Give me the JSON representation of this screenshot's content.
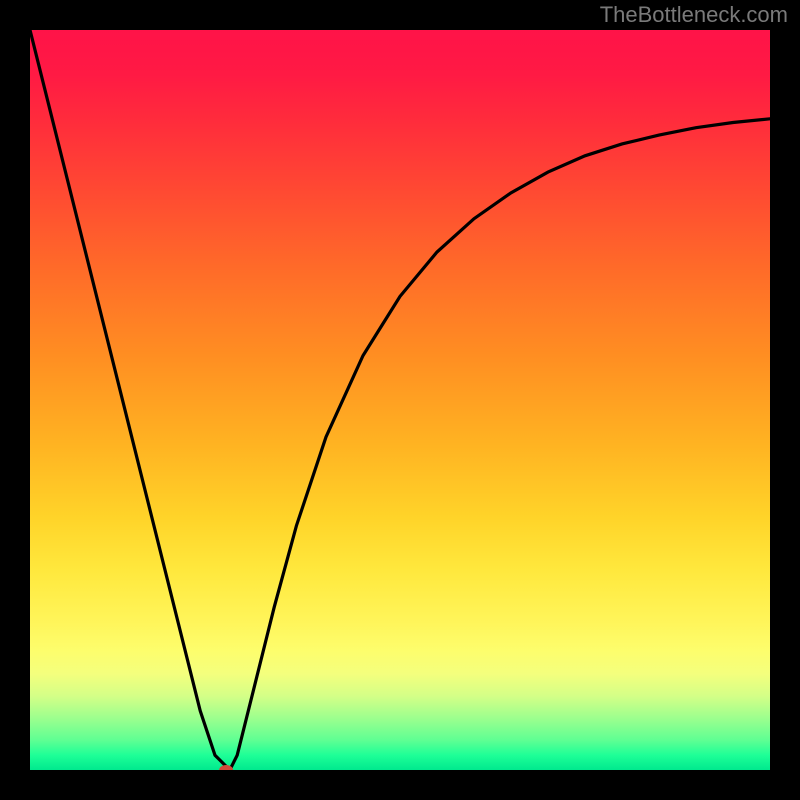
{
  "attribution": "TheBottleneck.com",
  "chart_data": {
    "type": "line",
    "title": "",
    "xlabel": "",
    "ylabel": "",
    "xlim": [
      0,
      100
    ],
    "ylim": [
      0,
      100
    ],
    "grid": false,
    "background_gradient": {
      "type": "vertical",
      "stops": [
        {
          "pos": 0,
          "color": "#ff1348"
        },
        {
          "pos": 50,
          "color": "#ffa020"
        },
        {
          "pos": 80,
          "color": "#fff55a"
        },
        {
          "pos": 100,
          "color": "#00e98e"
        }
      ]
    },
    "series": [
      {
        "name": "bottleneck-curve",
        "color": "#000000",
        "x": [
          0,
          5,
          10,
          15,
          20,
          23,
          25,
          27,
          28,
          30,
          33,
          36,
          40,
          45,
          50,
          55,
          60,
          65,
          70,
          75,
          80,
          85,
          90,
          95,
          100
        ],
        "values": [
          100,
          80,
          60,
          40,
          20,
          8,
          2,
          0,
          2,
          10,
          22,
          33,
          45,
          56,
          64,
          70,
          74.5,
          78,
          80.8,
          83,
          84.6,
          85.8,
          86.8,
          87.5,
          88
        ]
      }
    ],
    "marker": {
      "x": 26.5,
      "y": 0,
      "color": "#d04a3a"
    }
  }
}
